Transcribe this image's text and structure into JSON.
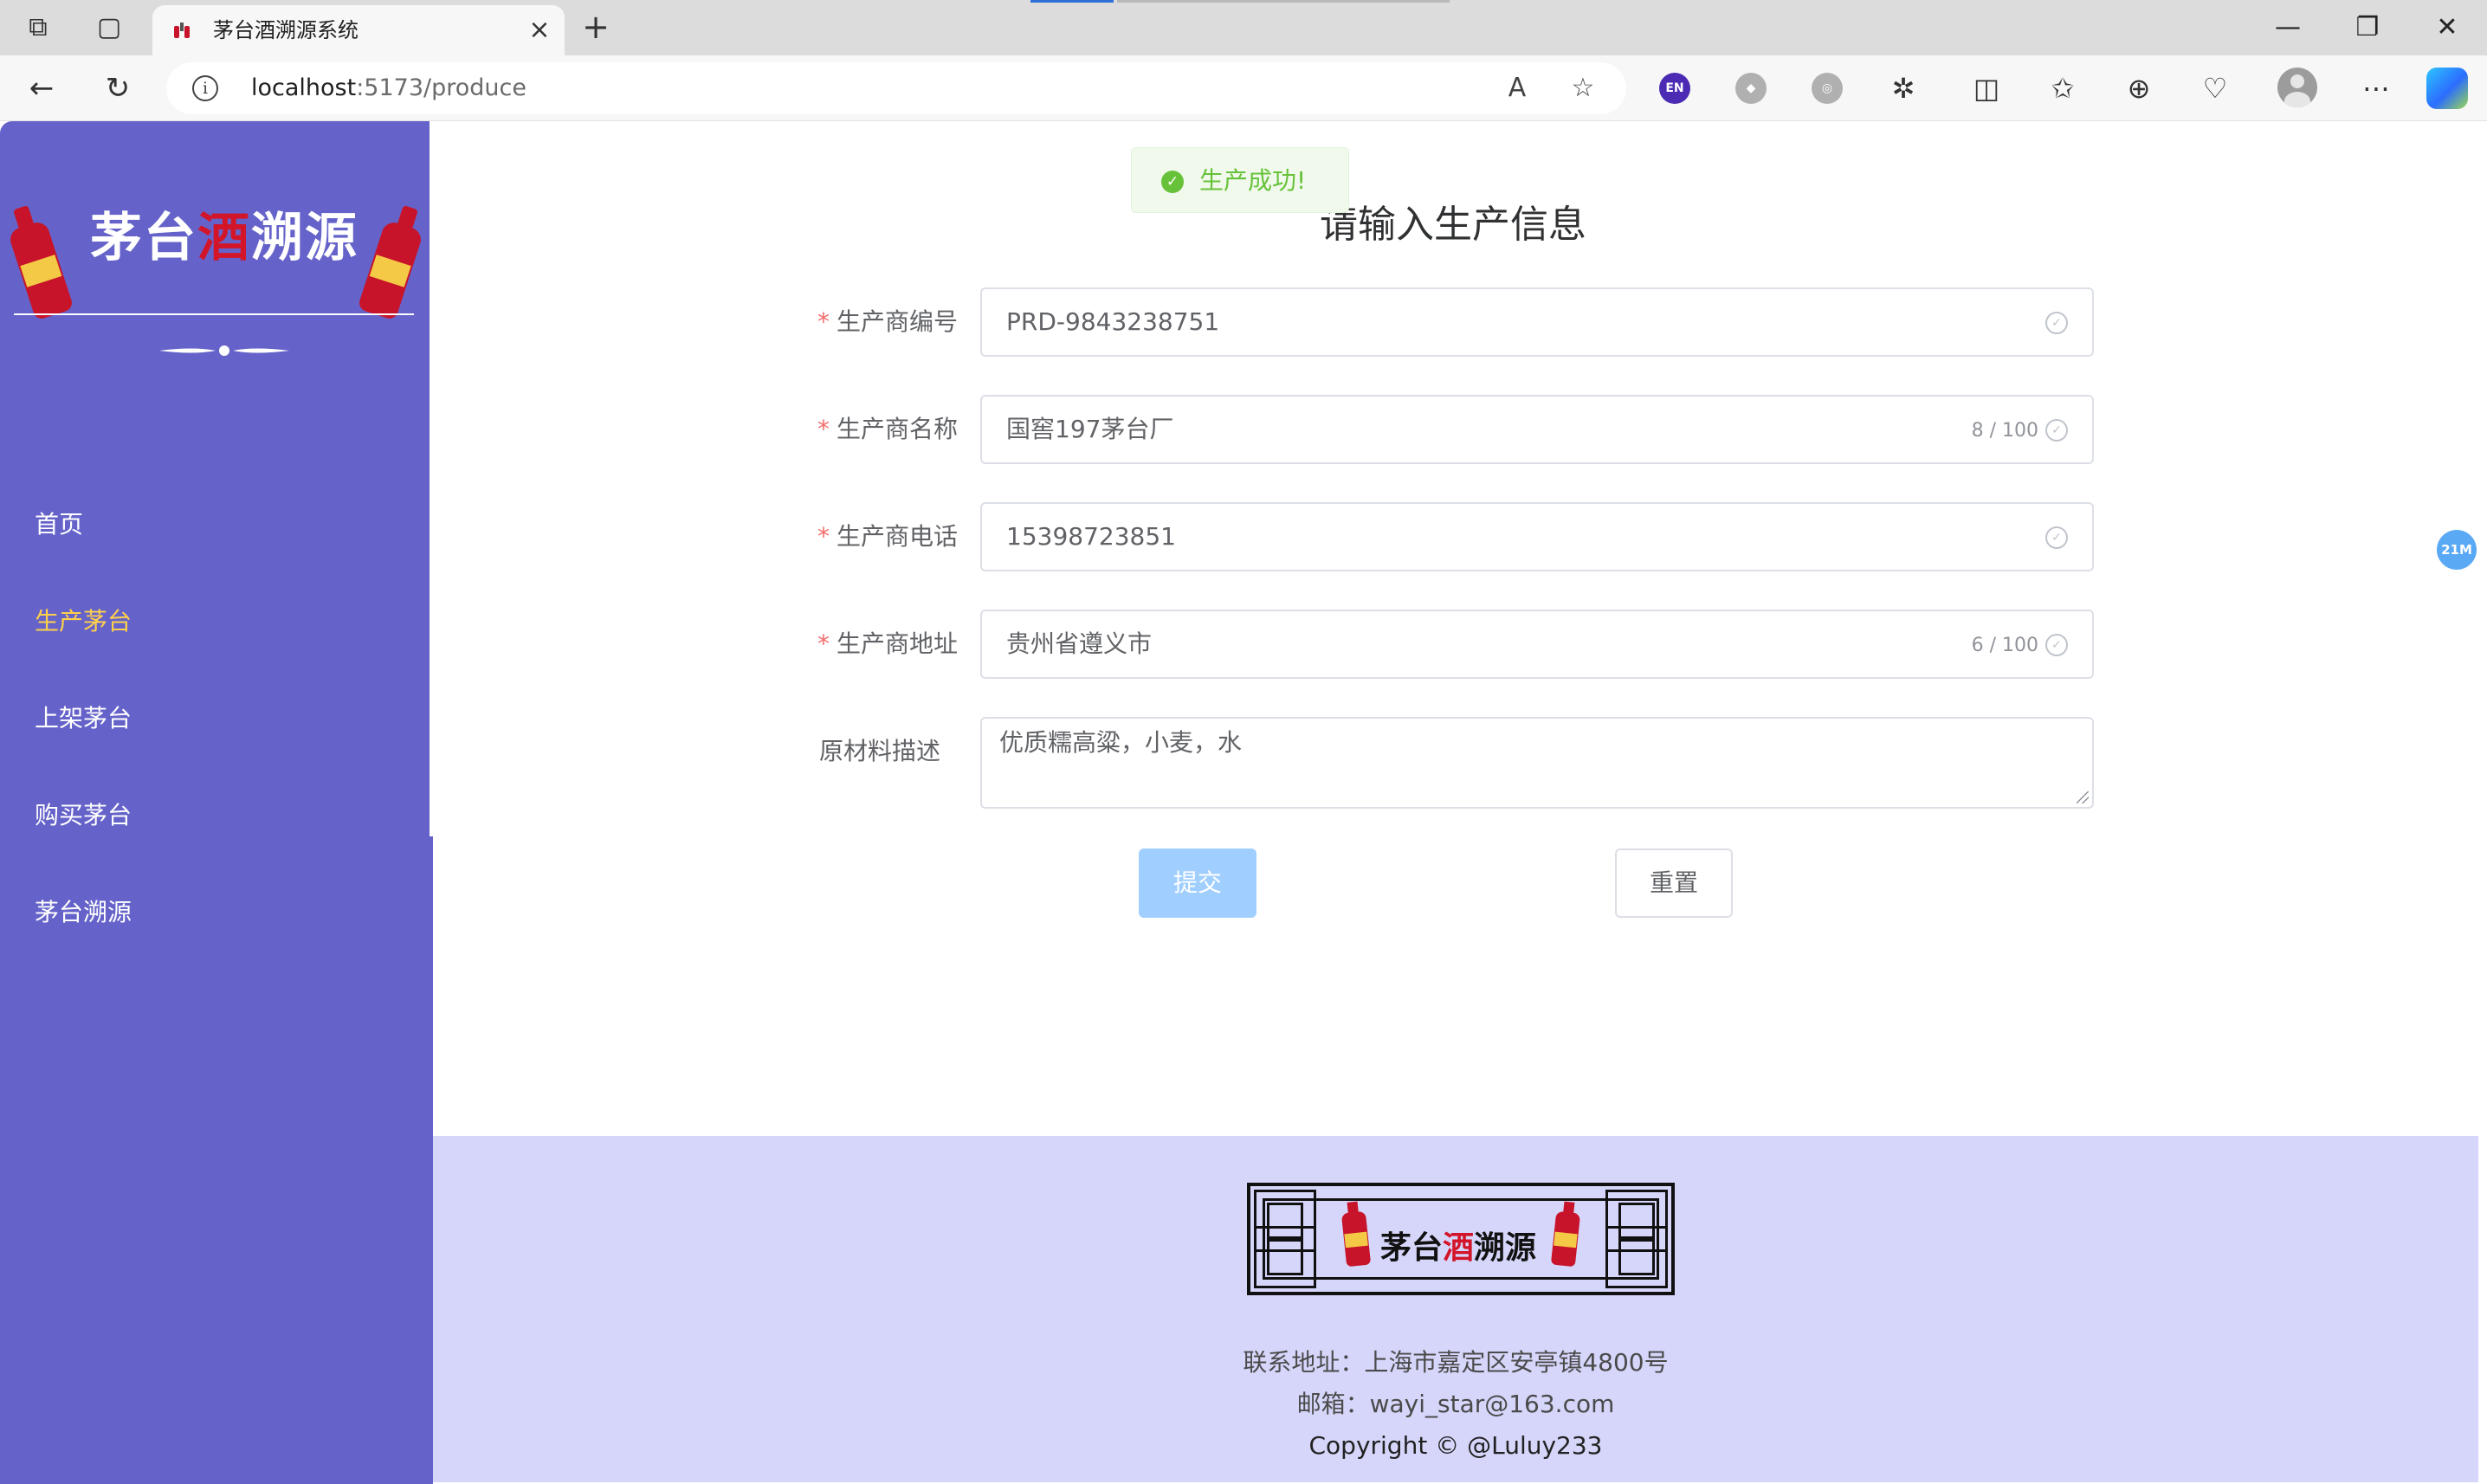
{
  "browser": {
    "tab_title": "茅台酒溯源系统",
    "url_host": "localhost",
    "url_path": ":5173/produce"
  },
  "sidebar": {
    "logo_text_1": "茅台",
    "logo_text_red": "酒",
    "logo_text_2": "溯源",
    "items": [
      {
        "label": "首页"
      },
      {
        "label": "生产茅台"
      },
      {
        "label": "上架茅台"
      },
      {
        "label": "购买茅台"
      },
      {
        "label": "茅台溯源"
      }
    ]
  },
  "toast": {
    "text": "生产成功!"
  },
  "form": {
    "title": "请输入生产信息",
    "fields": [
      {
        "label": "生产商编号",
        "value": "PRD-9843238751",
        "count": ""
      },
      {
        "label": "生产商名称",
        "value": "国窖197茅台厂",
        "count": "8 / 100"
      },
      {
        "label": "生产商电话",
        "value": "15398723851",
        "count": ""
      },
      {
        "label": "生产商地址",
        "value": "贵州省遵义市",
        "count": "6 / 100"
      },
      {
        "label": "原材料描述",
        "value": "优质糯高粱，小麦，水"
      }
    ],
    "submit_label": "提交",
    "reset_label": "重置"
  },
  "side_badge": "21M",
  "footer": {
    "address": "联系地址：上海市嘉定区安亭镇4800号",
    "email": "邮箱：wayi_star@163.com",
    "copyright": "Copyright © @Luluy233"
  },
  "colors": {
    "sidebar_bg": "#6563c9",
    "menu_active": "#ffd04b",
    "footer_bg": "#d6d6fb",
    "success": "#67c23a",
    "submit_disabled": "#a0cfff",
    "required": "#f56c6c"
  }
}
